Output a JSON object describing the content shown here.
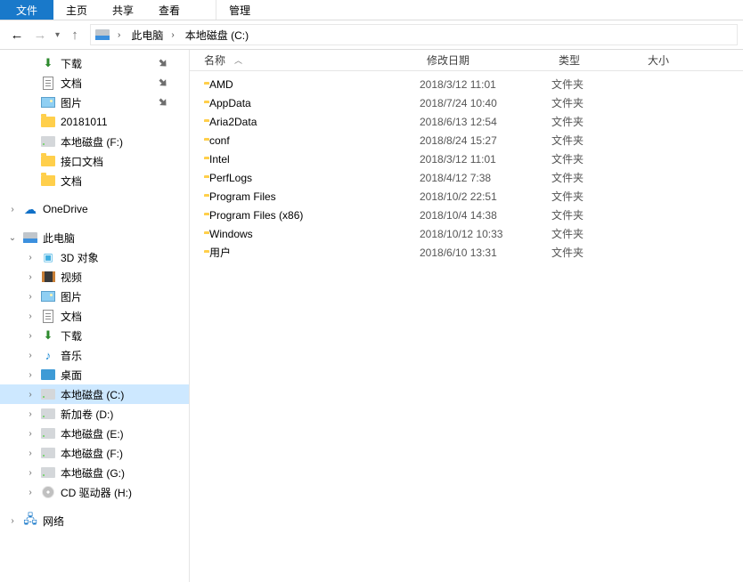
{
  "tabs": {
    "file": "文件",
    "home": "主页",
    "share": "共享",
    "view": "查看",
    "manage": "管理"
  },
  "breadcrumb": {
    "items": [
      "此电脑",
      "本地磁盘 (C:)"
    ]
  },
  "sidebar": {
    "quick": [
      {
        "label": "下载",
        "icon": "dl",
        "pinned": true
      },
      {
        "label": "文档",
        "icon": "doc",
        "pinned": true
      },
      {
        "label": "图片",
        "icon": "pic",
        "pinned": true
      },
      {
        "label": "20181011",
        "icon": "folder",
        "pinned": false
      },
      {
        "label": "本地磁盘 (F:)",
        "icon": "drive",
        "pinned": false
      },
      {
        "label": "接口文档",
        "icon": "folder",
        "pinned": false
      },
      {
        "label": "文档",
        "icon": "folder",
        "pinned": false
      }
    ],
    "onedrive": "OneDrive",
    "thispc": {
      "label": "此电脑",
      "children": [
        {
          "label": "3D 对象",
          "icon": "three"
        },
        {
          "label": "视频",
          "icon": "vid"
        },
        {
          "label": "图片",
          "icon": "pic"
        },
        {
          "label": "文档",
          "icon": "doc"
        },
        {
          "label": "下载",
          "icon": "dl"
        },
        {
          "label": "音乐",
          "icon": "music"
        },
        {
          "label": "桌面",
          "icon": "desk"
        },
        {
          "label": "本地磁盘 (C:)",
          "icon": "drive",
          "selected": true
        },
        {
          "label": "新加卷 (D:)",
          "icon": "drive"
        },
        {
          "label": "本地磁盘 (E:)",
          "icon": "drive"
        },
        {
          "label": "本地磁盘 (F:)",
          "icon": "drive"
        },
        {
          "label": "本地磁盘 (G:)",
          "icon": "drive"
        },
        {
          "label": "CD 驱动器 (H:)",
          "icon": "cd"
        }
      ]
    },
    "network": "网络"
  },
  "columns": {
    "name": "名称",
    "date": "修改日期",
    "type": "类型",
    "size": "大小"
  },
  "rows": [
    {
      "name": "AMD",
      "date": "2018/3/12 11:01",
      "type": "文件夹"
    },
    {
      "name": "AppData",
      "date": "2018/7/24 10:40",
      "type": "文件夹"
    },
    {
      "name": "Aria2Data",
      "date": "2018/6/13 12:54",
      "type": "文件夹"
    },
    {
      "name": "conf",
      "date": "2018/8/24 15:27",
      "type": "文件夹"
    },
    {
      "name": "Intel",
      "date": "2018/3/12 11:01",
      "type": "文件夹"
    },
    {
      "name": "PerfLogs",
      "date": "2018/4/12 7:38",
      "type": "文件夹"
    },
    {
      "name": "Program Files",
      "date": "2018/10/2 22:51",
      "type": "文件夹"
    },
    {
      "name": "Program Files (x86)",
      "date": "2018/10/4 14:38",
      "type": "文件夹"
    },
    {
      "name": "Windows",
      "date": "2018/10/12 10:33",
      "type": "文件夹"
    },
    {
      "name": "用户",
      "date": "2018/6/10 13:31",
      "type": "文件夹"
    }
  ]
}
